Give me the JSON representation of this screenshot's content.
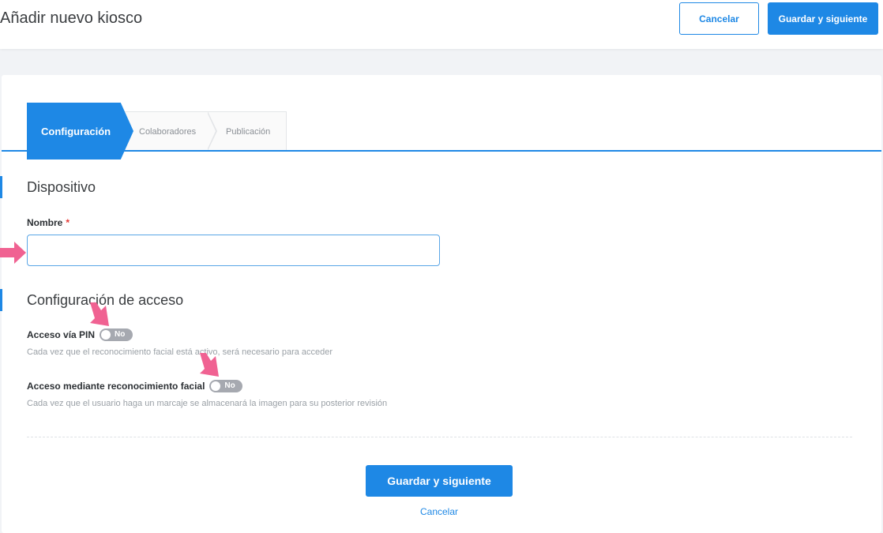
{
  "header": {
    "title": "Añadir nuevo kiosco",
    "cancel_label": "Cancelar",
    "save_label": "Guardar y siguiente"
  },
  "steps": [
    {
      "label": "Configuración",
      "active": true
    },
    {
      "label": "Colaboradores",
      "active": false
    },
    {
      "label": "Publicación",
      "active": false
    }
  ],
  "device_section": {
    "title": "Dispositivo",
    "name_label": "Nombre",
    "required_mark": "*",
    "name_value": ""
  },
  "access_section": {
    "title": "Configuración de acceso",
    "pin": {
      "label": "Acceso vía PIN",
      "toggle_text": "No",
      "help": "Cada vez que el reconocimiento facial está activo, será necesario para acceder"
    },
    "facial": {
      "label": "Acceso mediante reconocimiento facial",
      "toggle_text": "No",
      "help": "Cada vez que el usuario haga un marcaje se almacenará la imagen para su posterior revisión"
    }
  },
  "footer": {
    "save_label": "Guardar y siguiente",
    "cancel_label": "Cancelar"
  },
  "colors": {
    "accent": "#1e88e5",
    "annotation_arrow": "#f06292",
    "toggle_off": "#a6a9b0"
  }
}
